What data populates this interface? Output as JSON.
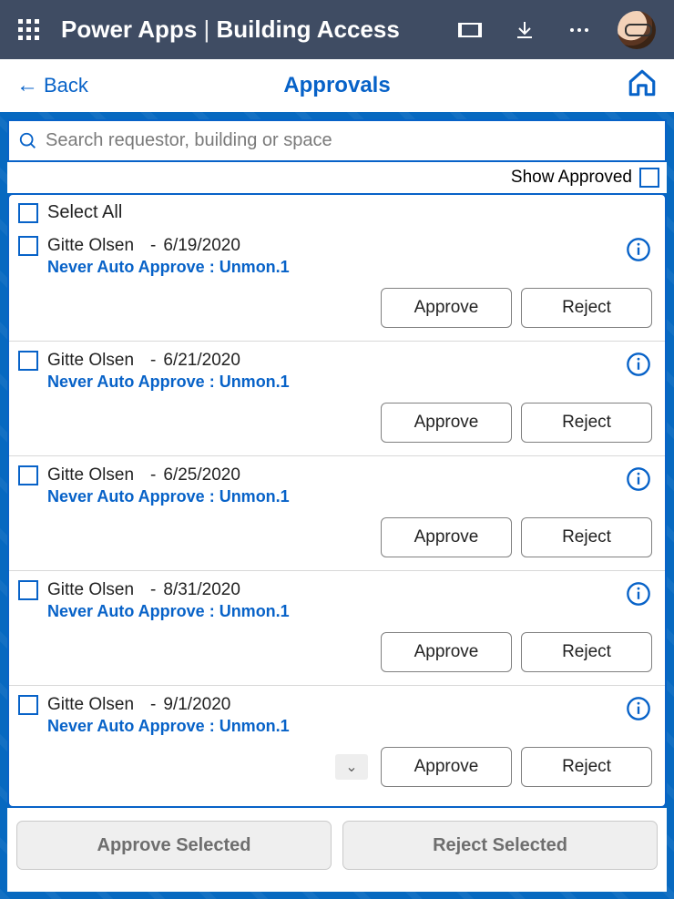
{
  "titlebar": {
    "app_name": "Power Apps",
    "separator": " | ",
    "page_name": "Building Access"
  },
  "subheader": {
    "back_label": "Back",
    "title": "Approvals"
  },
  "search": {
    "placeholder": "Search requestor, building or space",
    "value": ""
  },
  "controls": {
    "show_approved_label": "Show Approved",
    "select_all_label": "Select All"
  },
  "buttons": {
    "approve": "Approve",
    "reject": "Reject",
    "approve_selected": "Approve Selected",
    "reject_selected": "Reject Selected"
  },
  "requests": [
    {
      "name": "Gitte Olsen",
      "date": "6/19/2020",
      "detail": "Never Auto Approve : Unmon.1"
    },
    {
      "name": "Gitte Olsen",
      "date": "6/21/2020",
      "detail": "Never Auto Approve : Unmon.1"
    },
    {
      "name": "Gitte Olsen",
      "date": "6/25/2020",
      "detail": "Never Auto Approve : Unmon.1"
    },
    {
      "name": "Gitte Olsen",
      "date": "8/31/2020",
      "detail": "Never Auto Approve : Unmon.1"
    },
    {
      "name": "Gitte Olsen",
      "date": "9/1/2020",
      "detail": "Never Auto Approve : Unmon.1"
    }
  ]
}
